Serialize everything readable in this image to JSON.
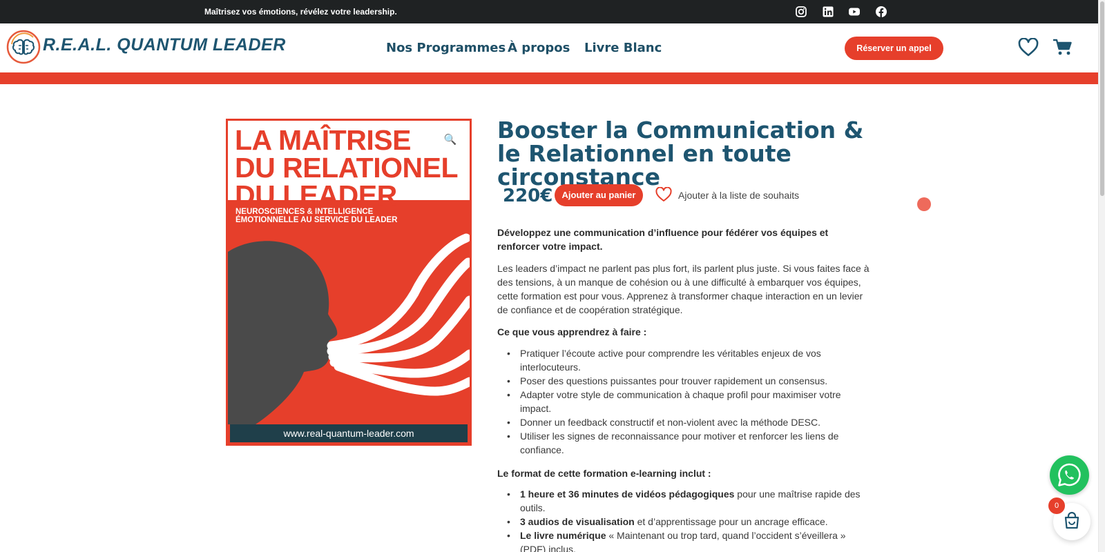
{
  "topbar": {
    "tagline": "Maîtrisez vos émotions, révélez votre leadership.",
    "social_icons": [
      "instagram-icon",
      "linkedin-icon",
      "youtube-icon",
      "facebook-icon"
    ]
  },
  "header": {
    "logo_text": "R.E.A.L. QUANTUM LEADER",
    "nav": [
      "Nos Programmes",
      "À propos",
      "Livre Blanc"
    ],
    "cta_label": "Réserver un appel"
  },
  "cover": {
    "title_lines": [
      "LA MAÎTRISE",
      "DU RELATIONEL",
      "DU LEADER"
    ],
    "subtitle_lines": [
      "NEUROSCIENCES & INTELLIGENCE",
      "ÉMOTIONNELLE AU SERVICE DU LEADER"
    ],
    "footer_url": "www.real-quantum-leader.com"
  },
  "product": {
    "title": "Booster la Communication & le Relationnel en toute circonstance",
    "price": "220€",
    "add_to_cart_label": "Ajouter au panier",
    "wishlist_label": "Ajouter à la liste de souhaits",
    "lead": "Développez une communication d’influence pour fédérer vos équipes et renforcer votre impact.",
    "intro": "Les leaders d’impact ne parlent pas plus fort, ils parlent plus juste. Si vous faites face à des tensions, à un manque de cohésion ou à une difficulté à embarquer vos équipes, cette formation est pour vous. Apprenez à transformer chaque interaction en un levier de confiance et de coopération stratégique.",
    "learn_heading": "Ce que vous apprendrez à faire :",
    "learn_items": [
      "Pratiquer l’écoute active pour comprendre les véritables enjeux de vos interlocuteurs.",
      "Poser des questions puissantes pour trouver rapidement un consensus.",
      "Adapter votre style de communication à chaque profil pour maximiser votre impact.",
      "Donner un feedback constructif et non-violent avec la méthode DESC.",
      "Utiliser les signes de reconnaissance pour motiver et renforcer les liens de confiance."
    ],
    "format_heading": "Le format de cette formation e-learning inclut :",
    "format_items": [
      {
        "strong": "1 heure et 36 minutes de vidéos pédagogiques",
        "rest": " pour une maîtrise rapide des outils."
      },
      {
        "strong": "3 audios de visualisation",
        "rest": " et d’apprentissage pour un ancrage efficace."
      },
      {
        "strong": "Le livre numérique",
        "rest": " « Maintenant ou trop tard, quand l’occident s’éveillera » (PDF) inclus."
      }
    ]
  },
  "minicart": {
    "count": "0"
  },
  "colors": {
    "brand_red": "#e63f2b",
    "brand_blue": "#1e5570",
    "topbar": "#1f2223",
    "whatsapp": "#22c15e"
  }
}
